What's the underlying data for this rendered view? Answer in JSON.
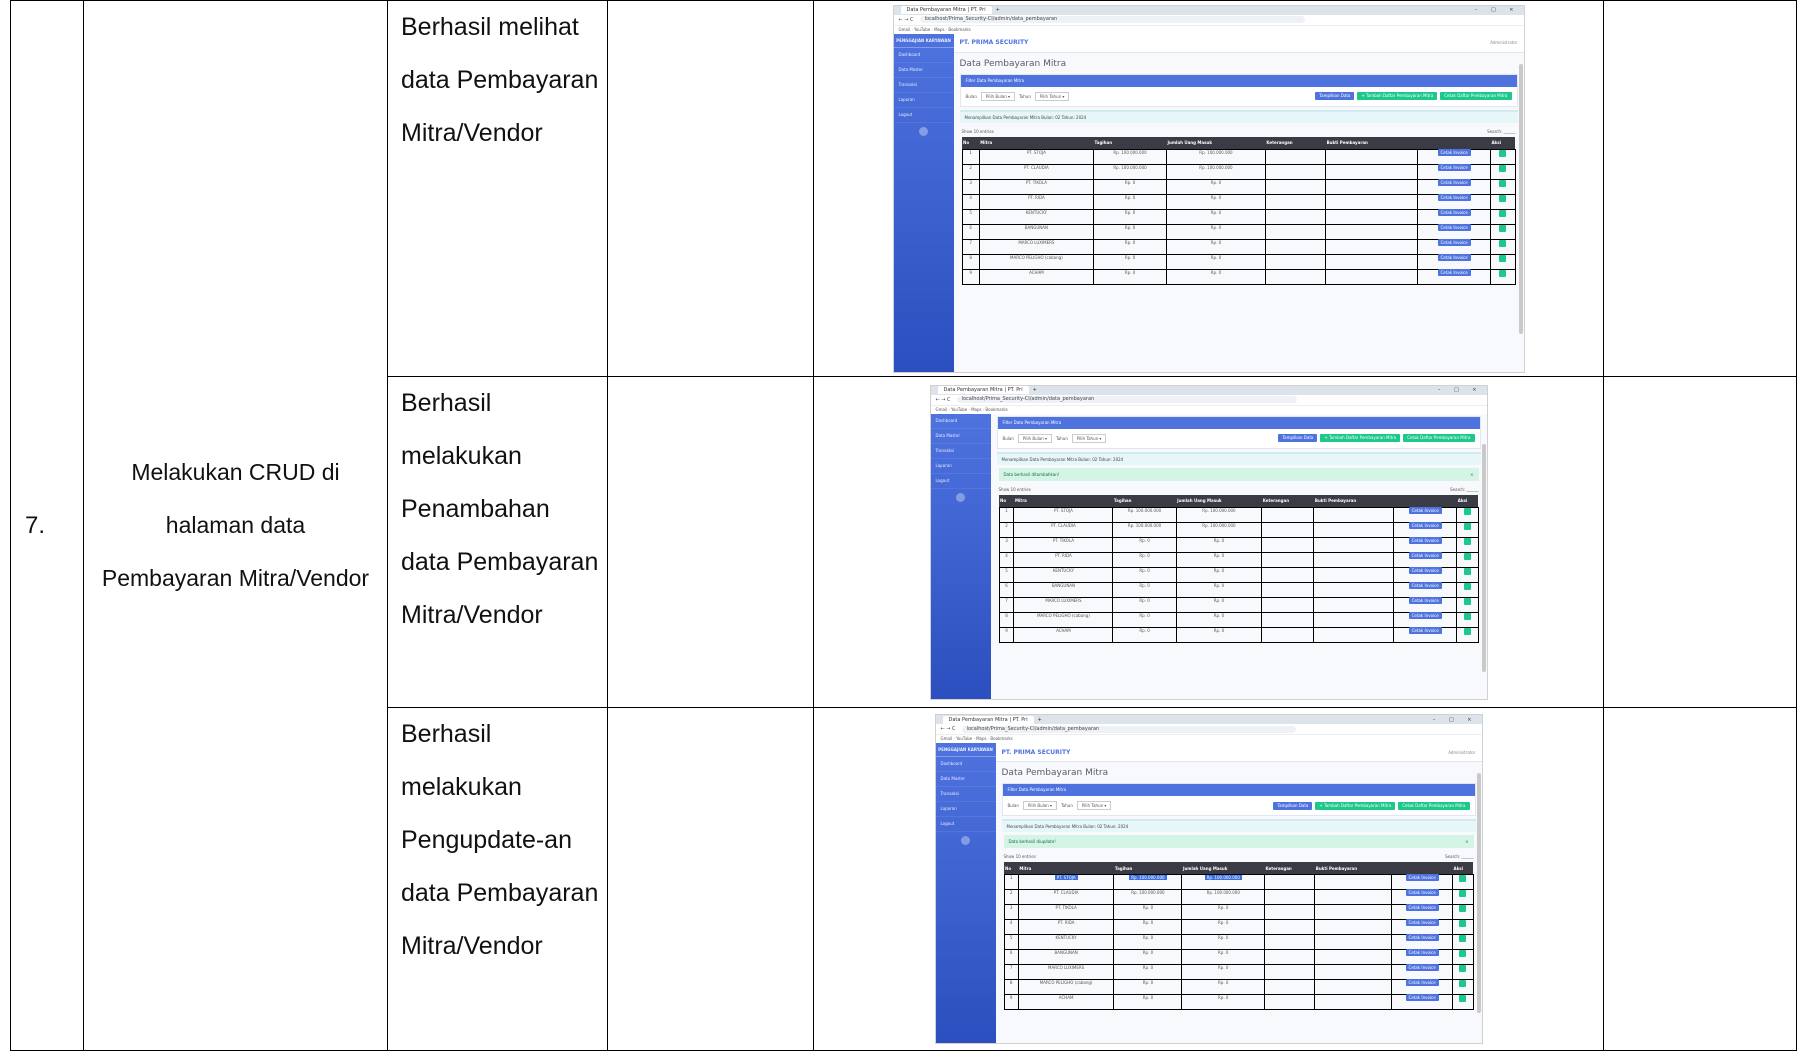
{
  "row_number": "7.",
  "description": "Melakukan CRUD di halaman data Pembayaran Mitra/Vendor",
  "results": [
    "Berhasil melihat data Pembayaran Mitra/Vendor",
    "Berhasil melakukan Penambahan data Pembayaran Mitra/Vendor",
    "Berhasil melakukan Pengupdate-an data Pembayaran Mitra/Vendor"
  ],
  "screenshot": {
    "tab_title": "Data Pembayaran Mitra | PT. Pri",
    "brand": "PENGGAJIAN KARYAWAN",
    "company": "PT. PRIMA SECURITY",
    "page_title": "Data Pembayaran Mitra",
    "card_header": "Filter Data Pembayaran Mitra",
    "filter_bulan_label": "Bulan",
    "filter_bulan_value": "Pilih Bulan",
    "filter_tahun_label": "Tahun",
    "filter_tahun_value": "Pilih Tahun",
    "btn_tampilkan": "Tampilkan Data",
    "btn_tambah": "+ Tambah Daftar Pembayaran Mitra",
    "btn_cetak": "Cetak Daftar Pembayaran Mitra",
    "info": "Menampilkan Data Pembayaran Mitra Bulan: 02 Tahun: 2024",
    "alert_added": "Data berhasil ditambahkan!",
    "alert_updated": "Data berhasil diupdate!",
    "show_entries": "Show 10 entries",
    "search_label": "Search:",
    "cetak_label": "Cetak Invoice",
    "nav": [
      "Dashboard",
      "Data Master",
      "Transaksi",
      "Laporan",
      "Logout"
    ],
    "columns": [
      "No",
      "Mitra",
      "Tagihan",
      "Jumlah Uang Masuk",
      "Keterangan",
      "Bukti Pembayaran",
      "",
      "Aksi"
    ],
    "rows": [
      {
        "no": "1",
        "mitra": "PT. STOJA",
        "tagihan": "Rp. 100.000.000",
        "masuk": "Rp. 100.000.000"
      },
      {
        "no": "2",
        "mitra": "PT. CLAUDIA",
        "tagihan": "Rp. 100.000.000",
        "masuk": "Rp. 100.000.000"
      },
      {
        "no": "3",
        "mitra": "PT. TIKOLA",
        "tagihan": "Rp. 0",
        "masuk": "Rp. 0"
      },
      {
        "no": "4",
        "mitra": "PT. RIDA",
        "tagihan": "Rp. 0",
        "masuk": "Rp. 0"
      },
      {
        "no": "5",
        "mitra": "KENTUCKY",
        "tagihan": "Rp. 0",
        "masuk": "Rp. 0"
      },
      {
        "no": "6",
        "mitra": "BANGUNAN",
        "tagihan": "Rp. 0",
        "masuk": "Rp. 0"
      },
      {
        "no": "7",
        "mitra": "MARCO LUXIMERS",
        "tagihan": "Rp. 0",
        "masuk": "Rp. 0"
      },
      {
        "no": "8",
        "mitra": "MARCO PELIGHO (cabang)",
        "tagihan": "Rp. 0",
        "masuk": "Rp. 0"
      },
      {
        "no": "9",
        "mitra": "ACHAM",
        "tagihan": "Rp. 0",
        "masuk": "Rp. 0"
      }
    ]
  }
}
